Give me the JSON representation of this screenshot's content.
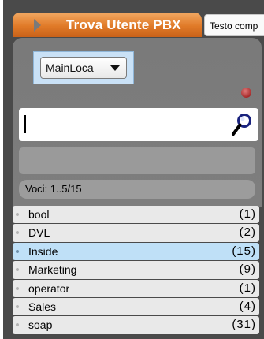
{
  "header": {
    "title": "Trova Utente PBX",
    "text_button_label": "Testo comp"
  },
  "location_select": {
    "value": "MainLoca"
  },
  "search": {
    "value": "",
    "icon": "search-icon"
  },
  "count_label": "Voci: 1..5/15",
  "groups": [
    {
      "label": "bool",
      "count": "(1)",
      "selected": false
    },
    {
      "label": "DVL",
      "count": "(2)",
      "selected": false
    },
    {
      "label": "Inside",
      "count": "(15)",
      "selected": true
    },
    {
      "label": "Marketing",
      "count": "(9)",
      "selected": false
    },
    {
      "label": "operator",
      "count": "(1)",
      "selected": false
    },
    {
      "label": "Sales",
      "count": "(4)",
      "selected": false
    },
    {
      "label": "soap",
      "count": "(31)",
      "selected": false
    }
  ],
  "colors": {
    "tab_accent": "#e07a28",
    "panel_bg": "#4a4a4a",
    "selected_row": "#bfe0f7",
    "status_dot": "#a62a2a"
  }
}
